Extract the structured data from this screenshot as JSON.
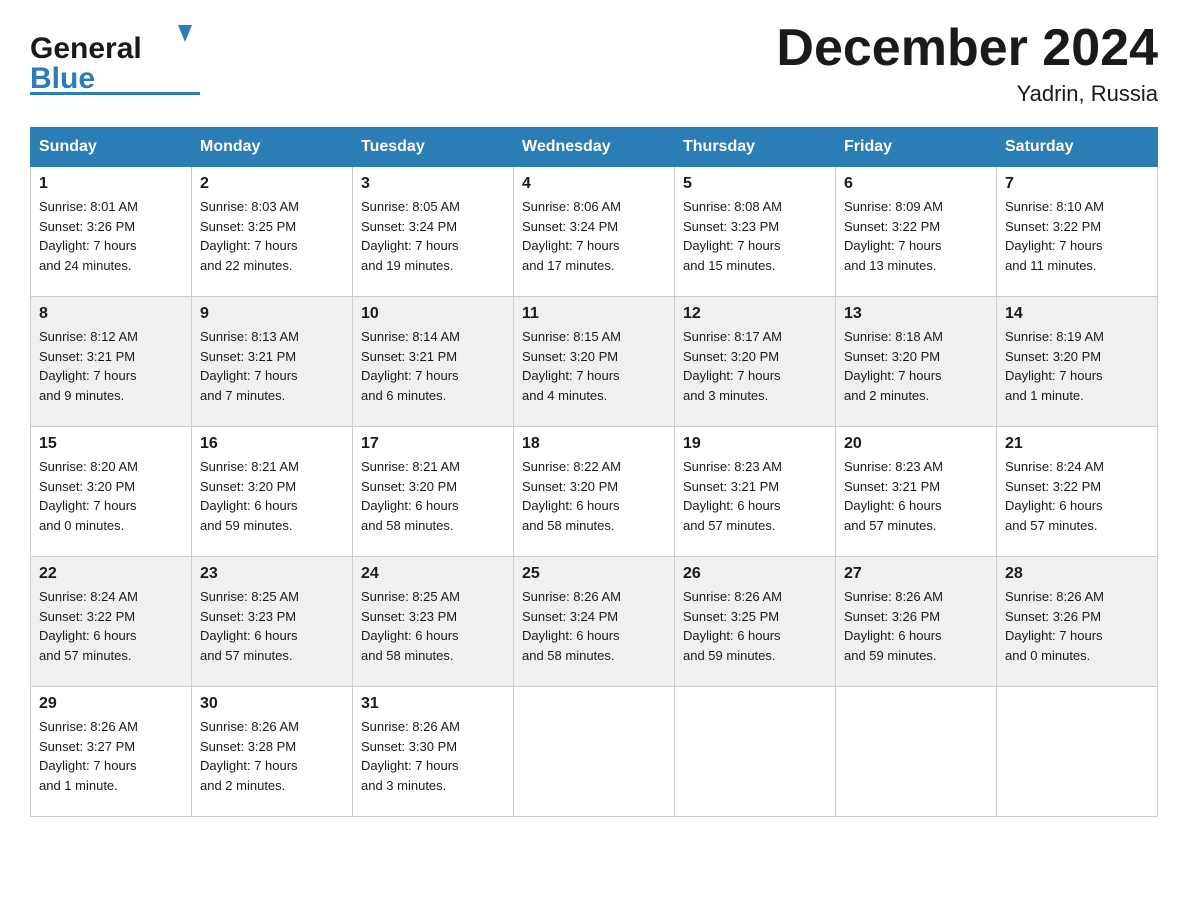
{
  "header": {
    "logo": {
      "general": "General",
      "blue": "Blue"
    },
    "title": "December 2024",
    "subtitle": "Yadrin, Russia"
  },
  "columns": [
    "Sunday",
    "Monday",
    "Tuesday",
    "Wednesday",
    "Thursday",
    "Friday",
    "Saturday"
  ],
  "weeks": [
    [
      {
        "day": 1,
        "sunrise": "8:01 AM",
        "sunset": "3:26 PM",
        "daylight": "7 hours and 24 minutes."
      },
      {
        "day": 2,
        "sunrise": "8:03 AM",
        "sunset": "3:25 PM",
        "daylight": "7 hours and 22 minutes."
      },
      {
        "day": 3,
        "sunrise": "8:05 AM",
        "sunset": "3:24 PM",
        "daylight": "7 hours and 19 minutes."
      },
      {
        "day": 4,
        "sunrise": "8:06 AM",
        "sunset": "3:24 PM",
        "daylight": "7 hours and 17 minutes."
      },
      {
        "day": 5,
        "sunrise": "8:08 AM",
        "sunset": "3:23 PM",
        "daylight": "7 hours and 15 minutes."
      },
      {
        "day": 6,
        "sunrise": "8:09 AM",
        "sunset": "3:22 PM",
        "daylight": "7 hours and 13 minutes."
      },
      {
        "day": 7,
        "sunrise": "8:10 AM",
        "sunset": "3:22 PM",
        "daylight": "7 hours and 11 minutes."
      }
    ],
    [
      {
        "day": 8,
        "sunrise": "8:12 AM",
        "sunset": "3:21 PM",
        "daylight": "7 hours and 9 minutes."
      },
      {
        "day": 9,
        "sunrise": "8:13 AM",
        "sunset": "3:21 PM",
        "daylight": "7 hours and 7 minutes."
      },
      {
        "day": 10,
        "sunrise": "8:14 AM",
        "sunset": "3:21 PM",
        "daylight": "7 hours and 6 minutes."
      },
      {
        "day": 11,
        "sunrise": "8:15 AM",
        "sunset": "3:20 PM",
        "daylight": "7 hours and 4 minutes."
      },
      {
        "day": 12,
        "sunrise": "8:17 AM",
        "sunset": "3:20 PM",
        "daylight": "7 hours and 3 minutes."
      },
      {
        "day": 13,
        "sunrise": "8:18 AM",
        "sunset": "3:20 PM",
        "daylight": "7 hours and 2 minutes."
      },
      {
        "day": 14,
        "sunrise": "8:19 AM",
        "sunset": "3:20 PM",
        "daylight": "7 hours and 1 minute."
      }
    ],
    [
      {
        "day": 15,
        "sunrise": "8:20 AM",
        "sunset": "3:20 PM",
        "daylight": "7 hours and 0 minutes."
      },
      {
        "day": 16,
        "sunrise": "8:21 AM",
        "sunset": "3:20 PM",
        "daylight": "6 hours and 59 minutes."
      },
      {
        "day": 17,
        "sunrise": "8:21 AM",
        "sunset": "3:20 PM",
        "daylight": "6 hours and 58 minutes."
      },
      {
        "day": 18,
        "sunrise": "8:22 AM",
        "sunset": "3:20 PM",
        "daylight": "6 hours and 58 minutes."
      },
      {
        "day": 19,
        "sunrise": "8:23 AM",
        "sunset": "3:21 PM",
        "daylight": "6 hours and 57 minutes."
      },
      {
        "day": 20,
        "sunrise": "8:23 AM",
        "sunset": "3:21 PM",
        "daylight": "6 hours and 57 minutes."
      },
      {
        "day": 21,
        "sunrise": "8:24 AM",
        "sunset": "3:22 PM",
        "daylight": "6 hours and 57 minutes."
      }
    ],
    [
      {
        "day": 22,
        "sunrise": "8:24 AM",
        "sunset": "3:22 PM",
        "daylight": "6 hours and 57 minutes."
      },
      {
        "day": 23,
        "sunrise": "8:25 AM",
        "sunset": "3:23 PM",
        "daylight": "6 hours and 57 minutes."
      },
      {
        "day": 24,
        "sunrise": "8:25 AM",
        "sunset": "3:23 PM",
        "daylight": "6 hours and 58 minutes."
      },
      {
        "day": 25,
        "sunrise": "8:26 AM",
        "sunset": "3:24 PM",
        "daylight": "6 hours and 58 minutes."
      },
      {
        "day": 26,
        "sunrise": "8:26 AM",
        "sunset": "3:25 PM",
        "daylight": "6 hours and 59 minutes."
      },
      {
        "day": 27,
        "sunrise": "8:26 AM",
        "sunset": "3:26 PM",
        "daylight": "6 hours and 59 minutes."
      },
      {
        "day": 28,
        "sunrise": "8:26 AM",
        "sunset": "3:26 PM",
        "daylight": "7 hours and 0 minutes."
      }
    ],
    [
      {
        "day": 29,
        "sunrise": "8:26 AM",
        "sunset": "3:27 PM",
        "daylight": "7 hours and 1 minute."
      },
      {
        "day": 30,
        "sunrise": "8:26 AM",
        "sunset": "3:28 PM",
        "daylight": "7 hours and 2 minutes."
      },
      {
        "day": 31,
        "sunrise": "8:26 AM",
        "sunset": "3:30 PM",
        "daylight": "7 hours and 3 minutes."
      },
      null,
      null,
      null,
      null
    ]
  ]
}
